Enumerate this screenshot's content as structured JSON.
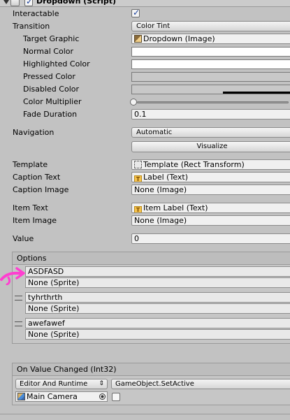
{
  "component": {
    "title": "Dropdown (Script)"
  },
  "props": {
    "interactable": "Interactable",
    "transition": {
      "label": "Transition",
      "value": "Color Tint"
    },
    "target_graphic": {
      "label": "Target Graphic",
      "value": "Dropdown (Image)"
    },
    "normal_color": "Normal Color",
    "highlighted_color": "Highlighted Color",
    "pressed_color": "Pressed Color",
    "disabled_color": "Disabled Color",
    "color_multiplier": {
      "label": "Color Multiplier",
      "value": 0
    },
    "fade_duration": {
      "label": "Fade Duration",
      "value": "0.1"
    },
    "navigation": {
      "label": "Navigation",
      "value": "Automatic",
      "visualize": "Visualize"
    },
    "template": {
      "label": "Template",
      "value": "Template (Rect Transform)"
    },
    "caption_text": {
      "label": "Caption Text",
      "value": "Label (Text)"
    },
    "caption_image": {
      "label": "Caption Image",
      "value": "None (Image)"
    },
    "item_text": {
      "label": "Item Text",
      "value": "Item Label (Text)"
    },
    "item_image": {
      "label": "Item Image",
      "value": "None (Image)"
    },
    "value": {
      "label": "Value",
      "value": "0"
    }
  },
  "options": {
    "title": "Options",
    "items": [
      {
        "text": "ASDFASD",
        "sprite": "None (Sprite)"
      },
      {
        "text": "tyhrthrth",
        "sprite": "None (Sprite)"
      },
      {
        "text": "awefawef",
        "sprite": "None (Sprite)"
      }
    ]
  },
  "on_value_changed": {
    "title": "On Value Changed (Int32)",
    "runtime": "Editor And Runtime",
    "function": "GameObject.SetActive",
    "target": "Main Camera"
  },
  "colors": {
    "panel_bg": "#c2c2c2",
    "accent_check": "#1a3f9a",
    "annotation": "#ff3fd0"
  }
}
